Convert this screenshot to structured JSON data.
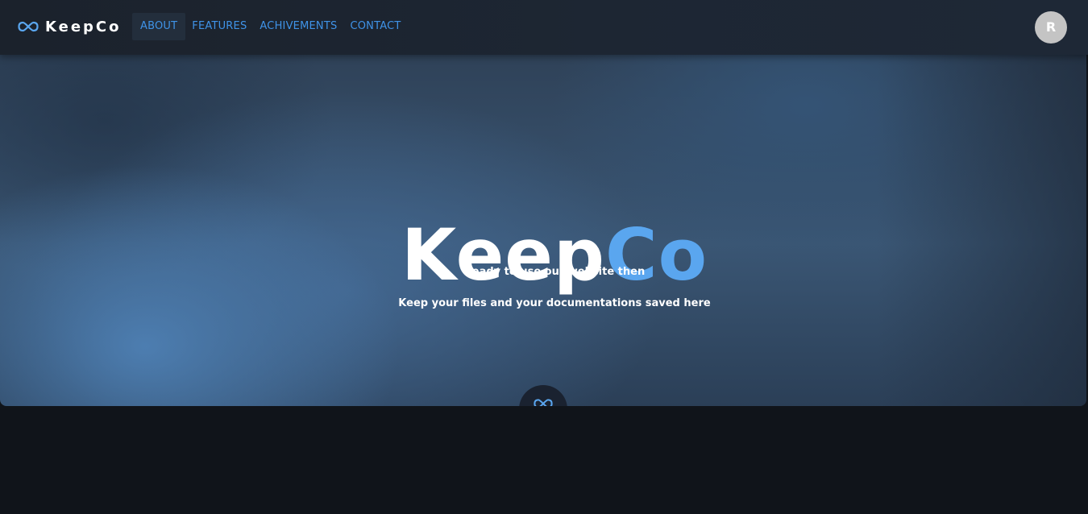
{
  "nav": {
    "brand": "KeepCo",
    "brand_icon": "infinity-icon",
    "links": [
      {
        "label": "ABOUT",
        "active": true
      },
      {
        "label": "FEATURES",
        "active": false
      },
      {
        "label": "ACHIVEMENTS",
        "active": false
      },
      {
        "label": "CONTACT",
        "active": false
      }
    ],
    "avatar_initial": "R"
  },
  "hero": {
    "title_part1": "Keep",
    "title_part2": "Co",
    "line1": "Ready to use our website then",
    "line2": "Keep your files and your documentations saved here",
    "badge_icon": "infinity-icon"
  },
  "colors": {
    "accent": "#5aa6ef",
    "nav_link": "#3f93e8",
    "background": "#10141a"
  }
}
